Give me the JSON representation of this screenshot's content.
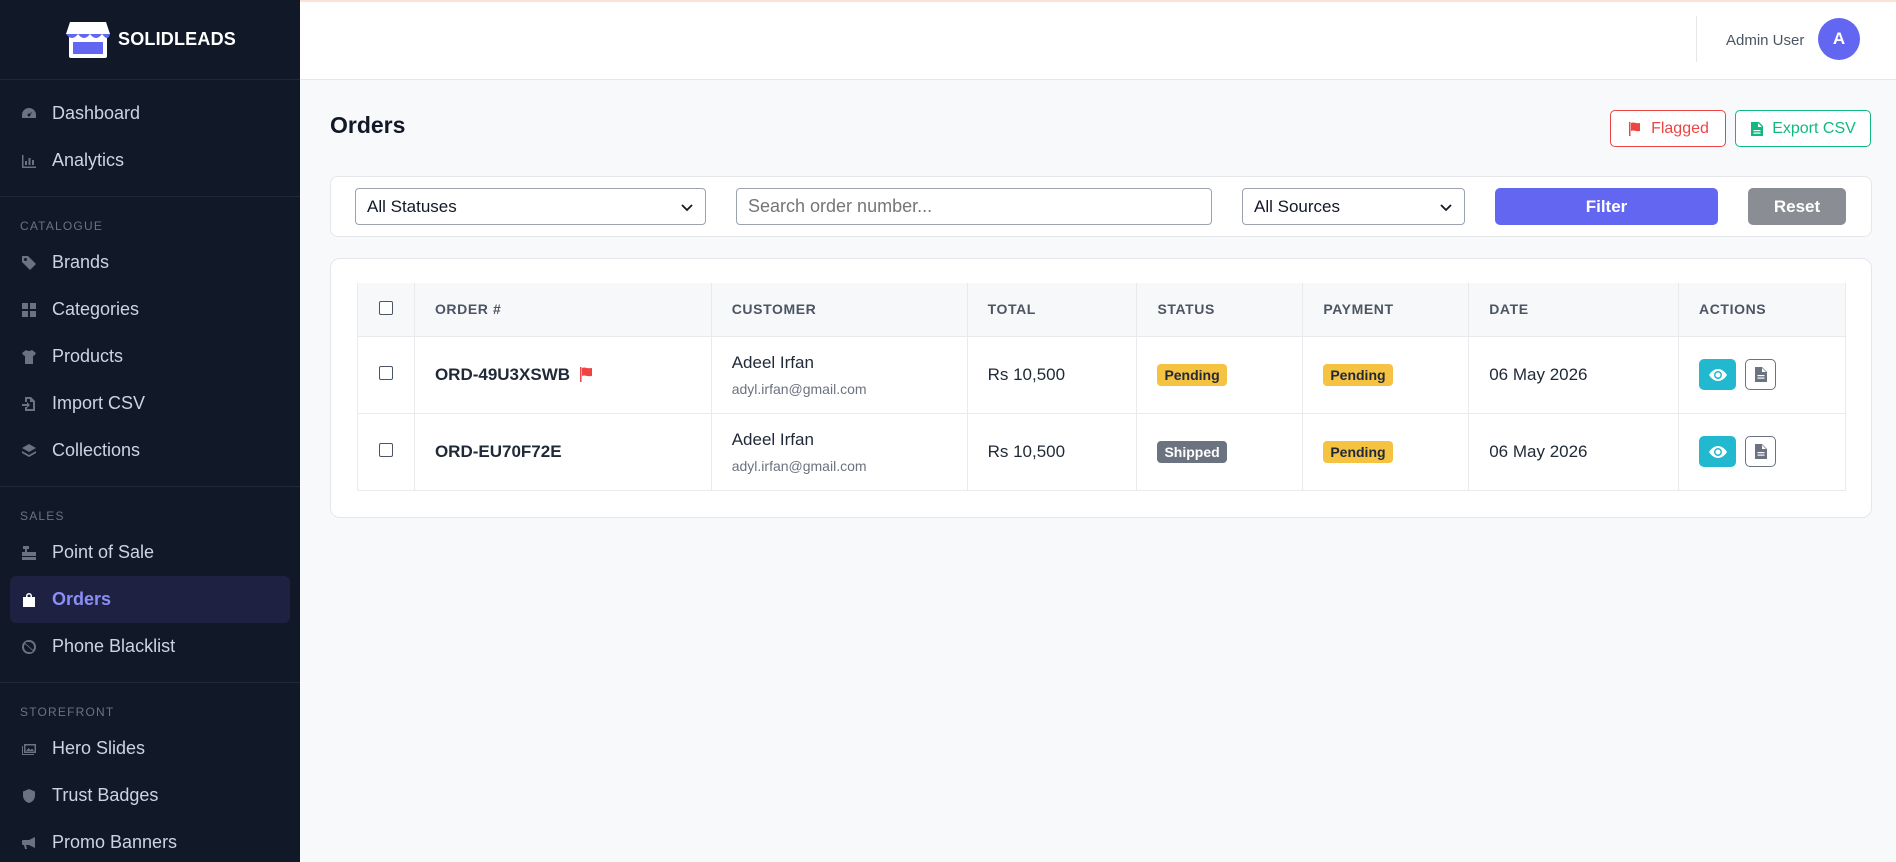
{
  "brand": {
    "name": "SOLIDLEADS"
  },
  "sidebar": {
    "top_items": [
      {
        "label": "Dashboard",
        "icon": "gauge-icon"
      },
      {
        "label": "Analytics",
        "icon": "chart-icon"
      }
    ],
    "sections": [
      {
        "title": "CATALOGUE",
        "items": [
          {
            "label": "Brands",
            "icon": "tag-icon"
          },
          {
            "label": "Categories",
            "icon": "grid-icon"
          },
          {
            "label": "Products",
            "icon": "shirt-icon"
          },
          {
            "label": "Import CSV",
            "icon": "file-import-icon"
          },
          {
            "label": "Collections",
            "icon": "layers-icon"
          }
        ]
      },
      {
        "title": "SALES",
        "items": [
          {
            "label": "Point of Sale",
            "icon": "cash-register-icon"
          },
          {
            "label": "Orders",
            "icon": "bag-icon",
            "active": true
          },
          {
            "label": "Phone Blacklist",
            "icon": "ban-icon"
          }
        ]
      },
      {
        "title": "STOREFRONT",
        "items": [
          {
            "label": "Hero Slides",
            "icon": "images-icon"
          },
          {
            "label": "Trust Badges",
            "icon": "shield-icon"
          },
          {
            "label": "Promo Banners",
            "icon": "megaphone-icon"
          }
        ]
      }
    ]
  },
  "topbar": {
    "user_name": "Admin User",
    "avatar_initial": "A"
  },
  "page": {
    "title": "Orders",
    "flagged_label": "Flagged",
    "export_label": "Export CSV"
  },
  "filters": {
    "status_value": "All Statuses",
    "search_placeholder": "Search order number...",
    "source_value": "All Sources",
    "filter_label": "Filter",
    "reset_label": "Reset"
  },
  "table": {
    "headers": [
      "ORDER #",
      "CUSTOMER",
      "TOTAL",
      "STATUS",
      "PAYMENT",
      "DATE",
      "ACTIONS"
    ],
    "rows": [
      {
        "order": "ORD-49U3XSWB",
        "flagged": true,
        "customer": "Adeel Irfan",
        "email": "adyl.irfan@gmail.com",
        "total": "Rs 10,500",
        "status": "Pending",
        "payment": "Pending",
        "date": "06 May 2026"
      },
      {
        "order": "ORD-EU70F72E",
        "flagged": false,
        "customer": "Adeel Irfan",
        "email": "adyl.irfan@gmail.com",
        "total": "Rs 10,500",
        "status": "Shipped",
        "payment": "Pending",
        "date": "06 May 2026"
      }
    ]
  },
  "colors": {
    "sidebar_bg": "#111827",
    "accent": "#6366f1",
    "danger": "#ef4444",
    "success": "#10b981",
    "info": "#22b8cf",
    "warning": "#f5c242"
  }
}
